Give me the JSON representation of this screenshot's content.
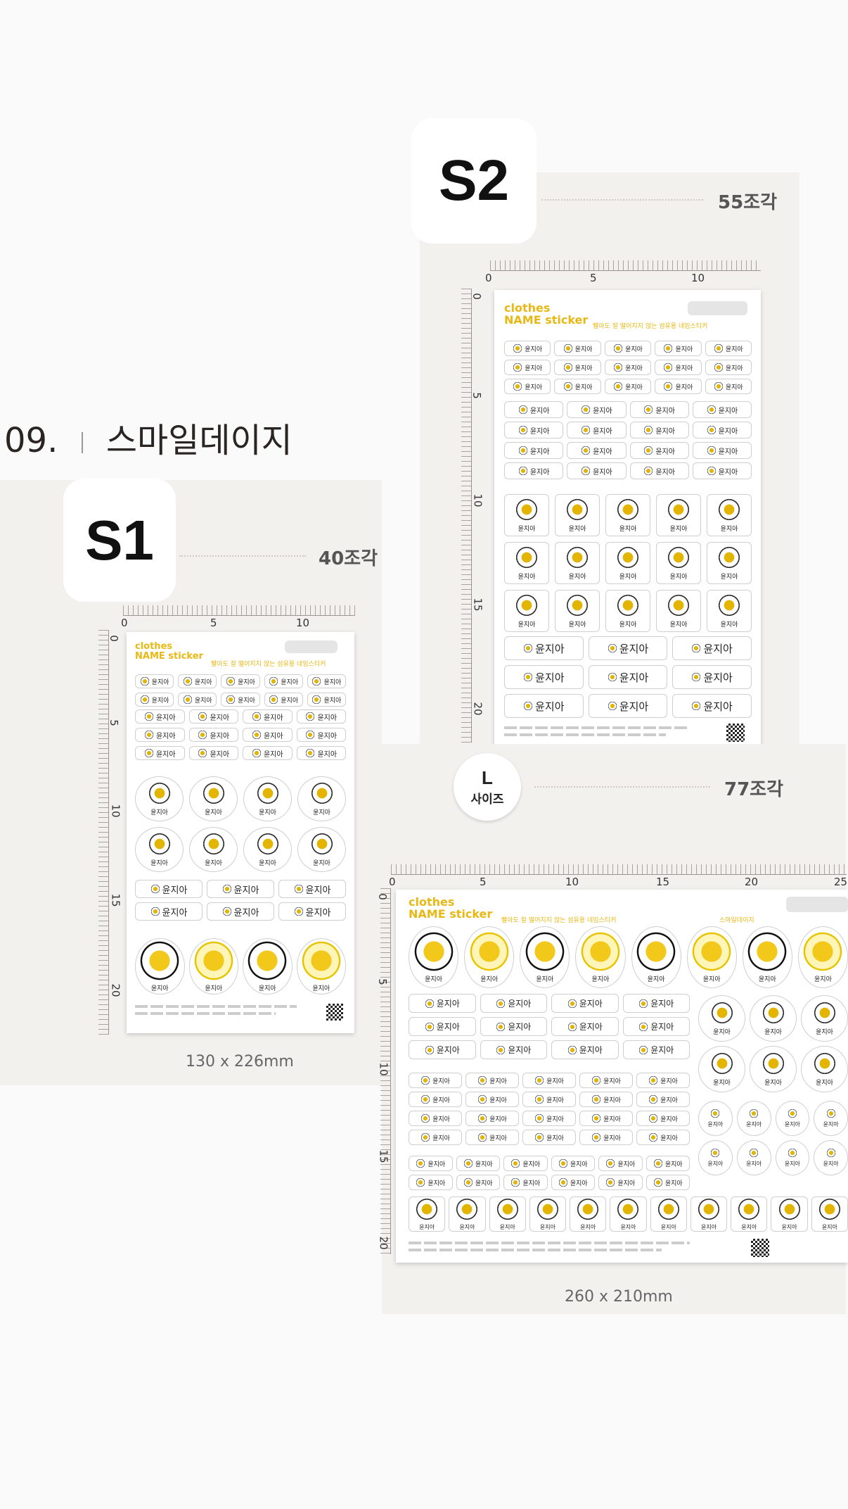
{
  "section": {
    "number": "09.",
    "name": "스마일데이지"
  },
  "s1": {
    "badge": "S1",
    "count": "40조각",
    "size": "130 x 226mm",
    "ruler_h": [
      "0",
      "5",
      "10"
    ],
    "ruler_v": [
      "0",
      "5",
      "10",
      "15",
      "20"
    ]
  },
  "s2": {
    "badge": "S2",
    "count": "55조각",
    "ruler_h": [
      "0",
      "5",
      "10"
    ],
    "ruler_v": [
      "0",
      "5",
      "10",
      "15",
      "20"
    ]
  },
  "l": {
    "badge_letter": "L",
    "badge_word": "사이즈",
    "count": "77조각",
    "size": "260 x 210mm",
    "ruler_h": [
      "0",
      "5",
      "10",
      "15",
      "20",
      "25"
    ],
    "ruler_v": [
      "0",
      "5",
      "10",
      "15",
      "20"
    ],
    "top_right": "스마일데이지"
  },
  "sheet": {
    "brand_line1": "clothes",
    "brand_line2": "NAME sticker",
    "tagline": "빨아도 잘 떨어지지 않는 섬유용 네임스티커",
    "name": "윤지아"
  },
  "colors": {
    "accent": "#e8b815",
    "panel": "#f3f1ee"
  }
}
